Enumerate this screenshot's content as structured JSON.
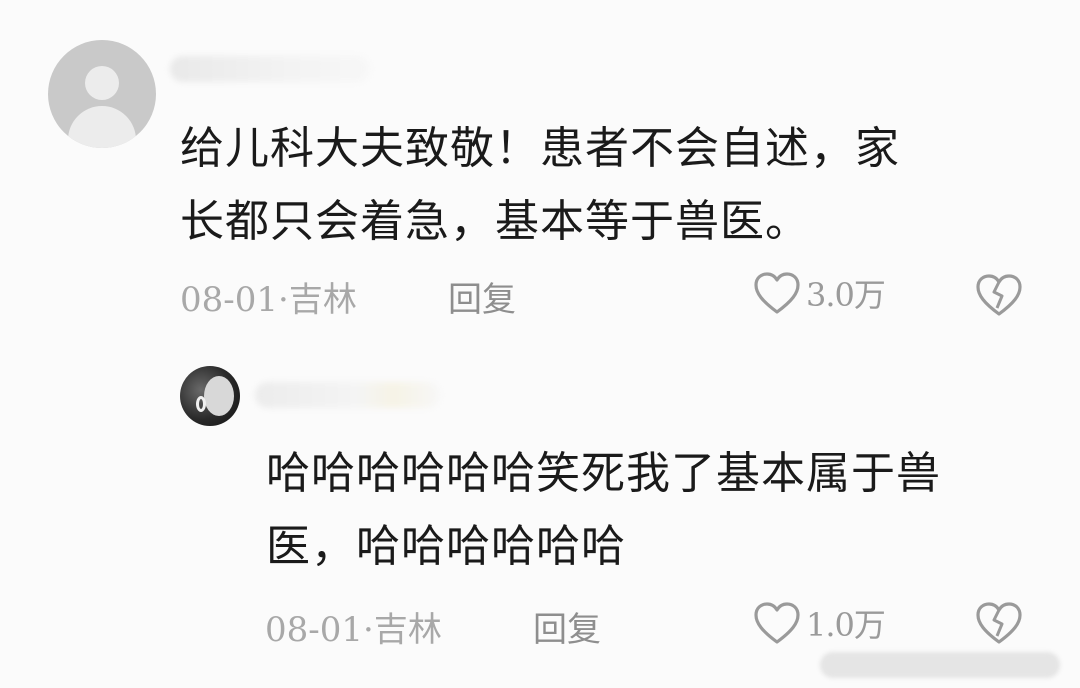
{
  "comments": [
    {
      "text_line1": "给儿科大夫致敬！患者不会自述，家",
      "text_line2": "长都只会着急，基本等于兽医。",
      "date_location": "08-01·吉林",
      "reply_label": "回复",
      "like_count": "3.0万",
      "avatar_icon": "default-user-icon"
    },
    {
      "text_line1": "哈哈哈哈哈哈笑死我了基本属于兽",
      "text_line2": "医，哈哈哈哈哈哈",
      "date_location": "08-01·吉林",
      "reply_label": "回复",
      "like_count": "1.0万",
      "avatar_icon": "user-photo-avatar"
    }
  ],
  "icons": {
    "like": "heart-outline-icon",
    "dislike": "broken-heart-icon"
  },
  "colors": {
    "text": "#1a1a1a",
    "meta": "#a8a8a8",
    "icon": "#9a9a9a"
  }
}
